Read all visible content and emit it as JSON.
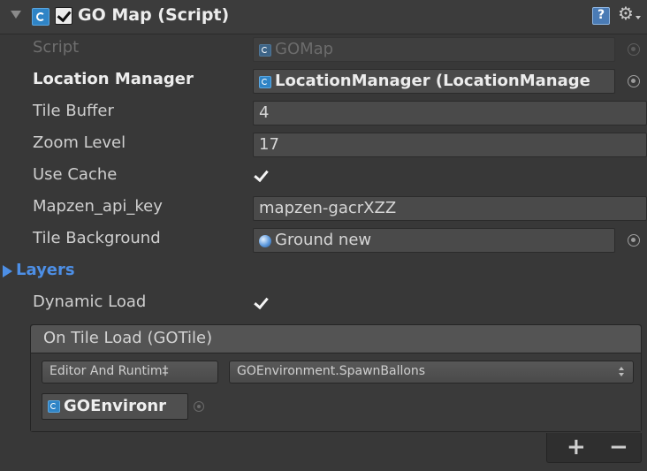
{
  "component": {
    "title": "GO Map (Script)",
    "enabled": true,
    "icons": [
      "csharp-script-icon",
      "help-icon",
      "gear-icon"
    ]
  },
  "properties": {
    "script": {
      "label": "Script",
      "value": "GOMap"
    },
    "location_manager": {
      "label": "Location Manager",
      "value": "LocationManager (LocationManage"
    },
    "tile_buffer": {
      "label": "Tile Buffer",
      "value": "4"
    },
    "zoom_level": {
      "label": "Zoom Level",
      "value": "17"
    },
    "use_cache": {
      "label": "Use Cache",
      "checked": true
    },
    "api_key": {
      "label": "Mapzen_api_key",
      "value": "mapzen-gacrXZZ"
    },
    "tile_background": {
      "label": "Tile Background",
      "value": "Ground new"
    },
    "layers": {
      "label": "Layers",
      "expanded": false
    },
    "dynamic_load": {
      "label": "Dynamic Load",
      "checked": true
    }
  },
  "event": {
    "title": "On Tile Load (GOTile)",
    "call_state": "Editor And Runtim‡",
    "function": "GOEnvironment.SpawnBallons",
    "target": "GOEnvironr"
  },
  "footer": {
    "plus": "+",
    "minus": "−"
  },
  "colors": {
    "background": "#383838",
    "foldout_blue": "#4d8fe6",
    "field": "#4a4a4a",
    "script_icon": "#2f84c6"
  }
}
